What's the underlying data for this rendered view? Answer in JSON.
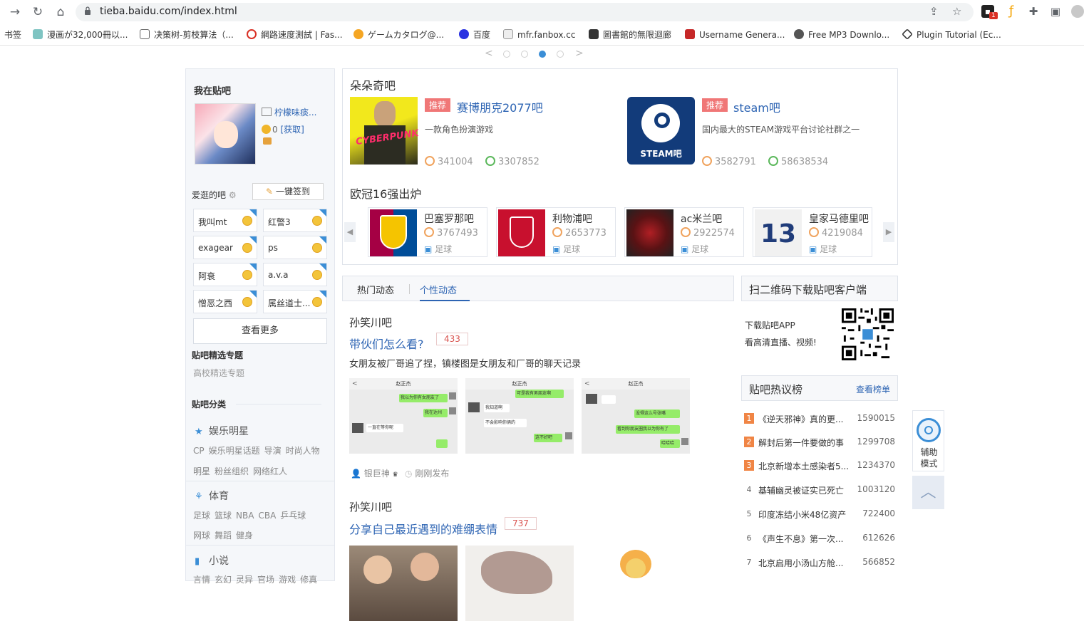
{
  "browser": {
    "url": "tieba.baidu.com/index.html",
    "bookmarks": [
      "书签",
      "漫画が32,000冊以...",
      "决策树-剪枝算法（...",
      "網路速度測試 | Fas...",
      "ゲームカタログ@...",
      "百度",
      "mfr.fanbox.cc",
      "圖書館的無限迴廊",
      "Username Genera...",
      "Free MP3 Downlo...",
      "Plugin Tutorial (Ec..."
    ],
    "ext_badge": "1"
  },
  "sidebar": {
    "heading": "我在贴吧",
    "username": "柠檬味痰...",
    "coins": "0",
    "get_link": "[获取]",
    "fav_heading": "爱逛的吧",
    "sign_button": "一键签到",
    "forums": [
      "我叫mt",
      "红警3",
      "exagear",
      "ps",
      "阿衰",
      "a.v.a",
      "憎恶之西",
      "属丝道士..."
    ],
    "more_button": "查看更多",
    "featured_heading": "贴吧精选专题",
    "featured_link": "高校精选专题",
    "category_heading": "贴吧分类",
    "categories": [
      {
        "name": "娱乐明星",
        "links_line1": [
          "CP",
          "娱乐明星话题",
          "导演",
          "时尚人物"
        ],
        "links_line2": [
          "明星",
          "粉丝组织",
          "网络红人"
        ]
      },
      {
        "name": "体育",
        "links_line1": [
          "足球",
          "篮球",
          "NBA",
          "CBA",
          "乒乓球"
        ],
        "links_line2": [
          "网球",
          "舞蹈",
          "健身"
        ]
      },
      {
        "name": "小说",
        "links_line1": [
          "言情",
          "玄幻",
          "灵异",
          "官场",
          "游戏",
          "修真"
        ]
      }
    ]
  },
  "recommend": {
    "title": "朵朵奇吧",
    "tag": "推荐",
    "cards": [
      {
        "name": "赛博朋克2077吧",
        "desc": "一款角色扮演游戏",
        "members": "341004",
        "posts": "3307852"
      },
      {
        "name": "steam吧",
        "desc": "国内最大的STEAM游戏平台讨论社群之一",
        "members": "3582791",
        "posts": "58638534",
        "logo_text": "STEAM吧"
      }
    ],
    "sub_title": "欧冠16强出炉",
    "clubs": [
      {
        "name": "巴塞罗那吧",
        "count": "3767493",
        "tag": "足球"
      },
      {
        "name": "利物浦吧",
        "count": "2653773",
        "tag": "足球"
      },
      {
        "name": "ac米兰吧",
        "count": "2922574",
        "tag": "足球"
      },
      {
        "name": "皇家马德里吧",
        "count": "4219084",
        "tag": "足球"
      }
    ]
  },
  "feed": {
    "tabs": [
      "热门动态",
      "个性动态"
    ],
    "posts": [
      {
        "bar": "孙笑川吧",
        "title": "带伙们怎么看?",
        "replies": "433",
        "desc": "女朋友被厂哥追了捏，镇楼图是女朋友和厂哥的聊天记录",
        "author": "银巨神",
        "time": "刚刚发布",
        "thumbs": [
          {
            "header": "赵正杰",
            "msgs": [
              "我以为你有女朋友了",
              "我在达州",
              "一直在等你呢"
            ]
          },
          {
            "header": "赵正杰",
            "msgs": [
              "可是我有男朋友啊",
              "我知道啊",
              "不会影响你俩的",
              "这不好吧"
            ]
          },
          {
            "header": "赵正杰",
            "msgs": [
              "没得这么号张嘴",
              "看到你朋友圈我以为你有了",
              "哈哈哈"
            ]
          }
        ]
      },
      {
        "bar": "孙笑川吧",
        "title": "分享自己最近遇到的难绷表情",
        "replies": "737"
      }
    ]
  },
  "right": {
    "qr_title": "扫二维码下载贴吧客户端",
    "app_line1": "下载贴吧APP",
    "app_line2": "看高清直播、视频!",
    "hot_title": "贴吧热议榜",
    "hot_more": "查看榜单",
    "hot": [
      {
        "rank": "1",
        "title": "《逆天邪神》真的更...",
        "count": "1590015"
      },
      {
        "rank": "2",
        "title": "解封后第一件要做的事",
        "count": "1299708"
      },
      {
        "rank": "3",
        "title": "北京新增本土感染者5...",
        "count": "1234370"
      },
      {
        "rank": "4",
        "title": "基辅幽灵被证实已死亡",
        "count": "1003120"
      },
      {
        "rank": "5",
        "title": "印度冻结小米48亿资产",
        "count": "722400"
      },
      {
        "rank": "6",
        "title": "《声生不息》第一次...",
        "count": "612626"
      },
      {
        "rank": "7",
        "title": "北京启用小汤山方舱...",
        "count": "566852"
      }
    ],
    "assist_line1": "辅助",
    "assist_line2": "模式"
  }
}
